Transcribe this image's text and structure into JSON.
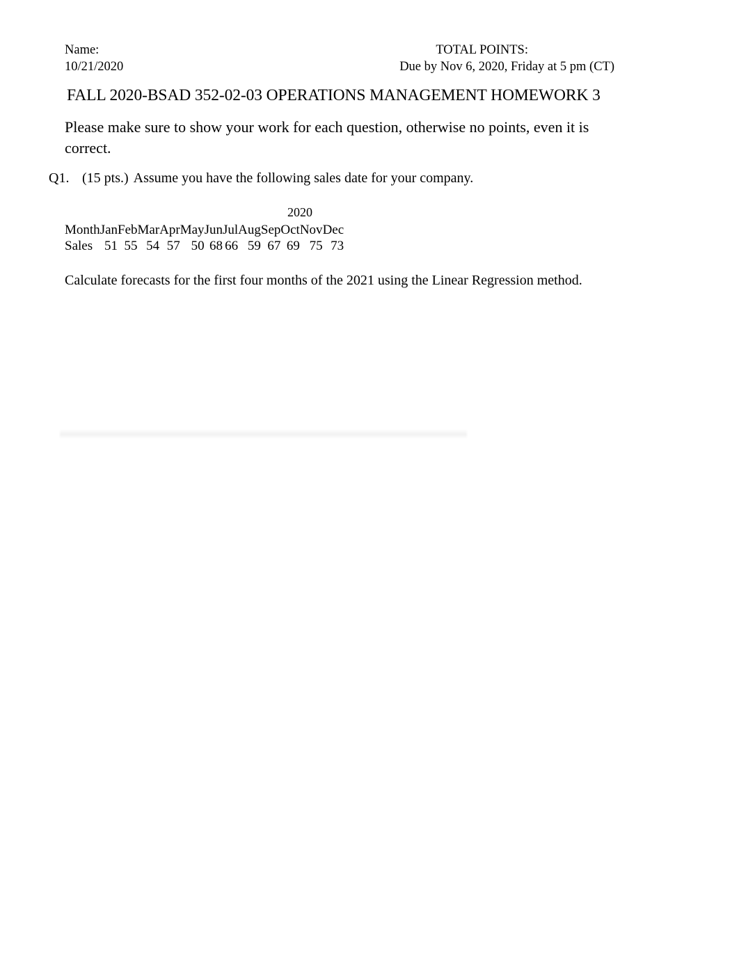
{
  "header": {
    "name_label": "Name:",
    "date": "10/21/2020",
    "total_points_label": "TOTAL POINTS:",
    "due_text": "Due by Nov 6, 2020, Friday at 5 pm (CT)"
  },
  "title": "FALL 2020-BSAD 352-02-03 OPERATIONS MANAGEMENT HOMEWORK 3",
  "instructions": "Please make sure to show your work for each question, otherwise no points, even it is correct.",
  "question": {
    "number": "Q1.",
    "points": "(15 pts.)",
    "text": "Assume you have the following sales date for your company.",
    "closing": "Calculate forecasts for the first four months of the 2021 using the Linear Regression method."
  },
  "table": {
    "year": "2020",
    "row_labels": [
      "Month",
      "Sales"
    ],
    "months": [
      "Jan",
      "Feb",
      "Mar",
      "Apr",
      "May",
      "Jun",
      "Jul",
      "Aug",
      "Sep",
      "Oct",
      "Nov",
      "Dec"
    ],
    "sales": [
      "51",
      "55",
      "54",
      "57",
      "50",
      "68",
      "66",
      "59",
      "67",
      "69",
      "75",
      "73"
    ]
  }
}
